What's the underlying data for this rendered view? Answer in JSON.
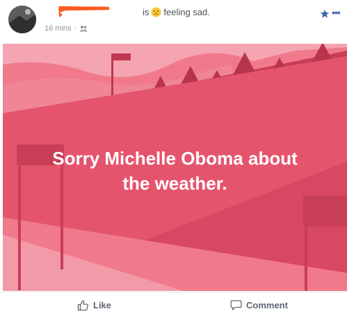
{
  "post": {
    "status_suffix": "is",
    "feeling_text": "feeling sad.",
    "timestamp": "16 mins",
    "separator": "·"
  },
  "banner": {
    "line1": "Sorry Michelle Oboma about",
    "line2": "the weather.",
    "colors": {
      "base": "#e5546d",
      "light": "#f07a8c",
      "dark": "#c83e56",
      "pale": "#f6a3b0"
    }
  },
  "actions": {
    "like": "Like",
    "comment": "Comment"
  },
  "icons": {
    "feeling": "sad-face-icon",
    "audience": "friends-icon",
    "star": "star-icon",
    "more": "more-icon",
    "like": "thumbs-up-icon",
    "comment": "comment-bubble-icon"
  },
  "accent_color": "#4267b2"
}
